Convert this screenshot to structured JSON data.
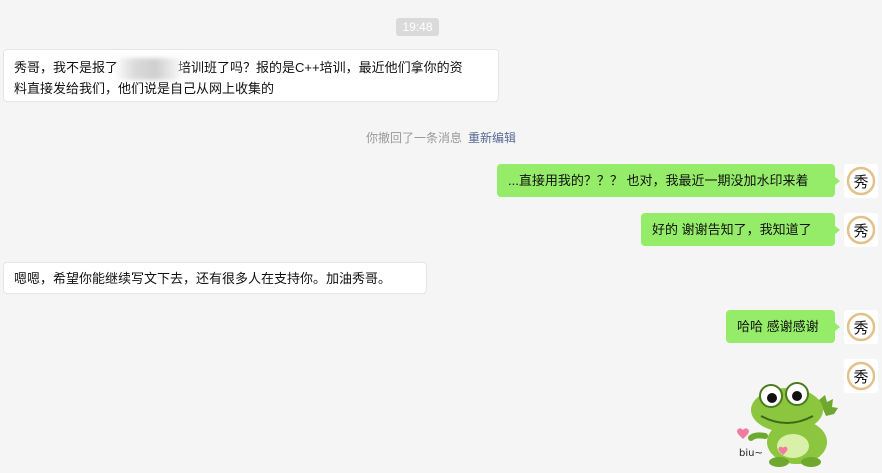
{
  "chat": {
    "timestamp": "19:48",
    "recall_notice": "你撤回了一条消息",
    "recall_action": "重新编辑",
    "messages": [
      {
        "side": "left",
        "text_a": "秀哥，我不是报了",
        "text_b": "培训班了吗？报的是C++培训，最近他们拿你的资",
        "text_c": "料直接发给我们，他们说是自己从网上收集的"
      },
      {
        "side": "right",
        "text": "...直接用我的？？？ 也对，我最近一期没加水印来着"
      },
      {
        "side": "right",
        "text": "好的 谢谢告知了，我知道了"
      },
      {
        "side": "left",
        "text": "嗯嗯，希望你能继续写文下去，还有很多人在支持你。加油秀哥。"
      },
      {
        "side": "right",
        "text": "哈哈 感谢感谢"
      }
    ],
    "avatar_glyph": "秀",
    "sticker_caption": "biu~"
  },
  "colors": {
    "background": "#f5f5f5",
    "bubble_self": "#95ec69",
    "bubble_other": "#ffffff",
    "link": "#576b95"
  }
}
